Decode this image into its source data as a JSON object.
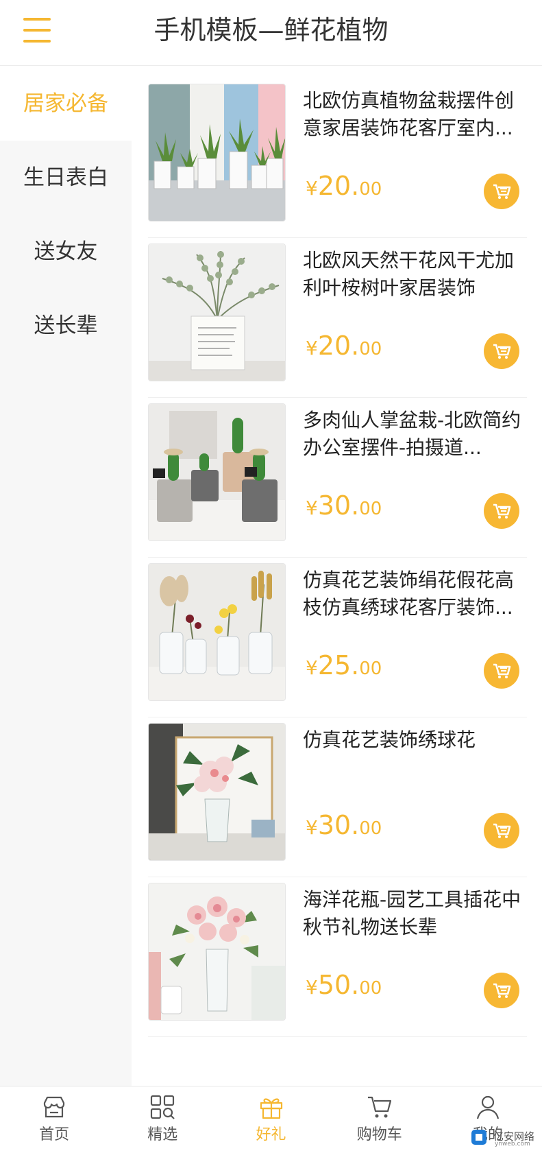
{
  "header": {
    "title": "手机模板—鲜花植物",
    "menu_icon": "hamburger-menu-icon"
  },
  "sidebar": {
    "items": [
      {
        "label": "居家必备",
        "active": true
      },
      {
        "label": "生日表白",
        "active": false
      },
      {
        "label": "送女友",
        "active": false
      },
      {
        "label": "送长辈",
        "active": false
      }
    ]
  },
  "products": [
    {
      "title": "北欧仿真植物盆栽摆件创意家居装饰花客厅室内...",
      "currency": "¥",
      "price_int": "20.",
      "price_dec": "00",
      "image": "succulent-pots-photo"
    },
    {
      "title": "北欧风天然干花风干尤加利叶桉树叶家居装饰",
      "currency": "¥",
      "price_int": "20.",
      "price_dec": "00",
      "image": "eucalyptus-paper-bag-photo"
    },
    {
      "title": "多肉仙人掌盆栽-北欧简约办公室摆件-拍摄道...",
      "currency": "¥",
      "price_int": "30.",
      "price_dec": "00",
      "image": "cactus-tins-photo"
    },
    {
      "title": "仿真花艺装饰绢花假花高枝仿真绣球花客厅装饰...",
      "currency": "¥",
      "price_int": "25.",
      "price_dec": "00",
      "image": "dried-flower-vases-photo"
    },
    {
      "title": "仿真花艺装饰绣球花",
      "currency": "¥",
      "price_int": "30.",
      "price_dec": "00",
      "image": "hydrangea-vase-photo"
    },
    {
      "title": "海洋花瓶-园艺工具插花中秋节礼物送长辈",
      "currency": "¥",
      "price_int": "50.",
      "price_dec": "00",
      "image": "rose-bouquet-vase-photo"
    }
  ],
  "tabbar": {
    "items": [
      {
        "label": "首页",
        "icon": "store-icon",
        "active": false
      },
      {
        "label": "精选",
        "icon": "grid-search-icon",
        "active": false
      },
      {
        "label": "好礼",
        "icon": "gift-icon",
        "active": true
      },
      {
        "label": "购物车",
        "icon": "cart-icon",
        "active": false
      },
      {
        "label": "我的",
        "icon": "user-icon",
        "active": false
      }
    ]
  },
  "watermark": {
    "text": "亿安网络",
    "sub": "ynweb.com"
  },
  "colors": {
    "accent": "#f5b731",
    "sidebar_bg": "#f7f7f7",
    "text": "#222222"
  }
}
